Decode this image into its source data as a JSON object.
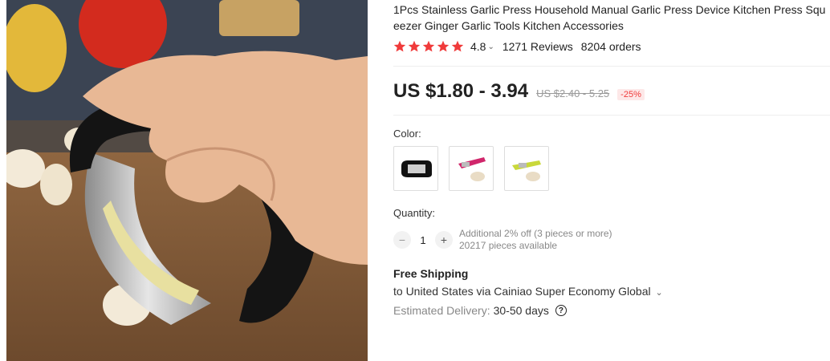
{
  "product": {
    "title_line1": "1Pcs Stainless Garlic Press Household Manual Garlic Press Device Kitchen Press Squ",
    "title_line2": "eezer Ginger Garlic Tools Kitchen Accessories",
    "image_icon": "garlic-press-photo"
  },
  "rating": {
    "stars": 5,
    "value": "4.8",
    "reviews": "1271 Reviews",
    "orders": "8204 orders",
    "star_color": "#f03b3b"
  },
  "price": {
    "current": "US $1.80 - 3.94",
    "original": "US $2.40 - 5.25",
    "discount": "-25%"
  },
  "color": {
    "label": "Color:",
    "options": [
      {
        "icon": "black-garlic-press-icon"
      },
      {
        "icon": "pink-garlic-press-icon"
      },
      {
        "icon": "yellow-garlic-press-icon"
      }
    ]
  },
  "quantity": {
    "label": "Quantity:",
    "value": "1",
    "minus": "−",
    "plus": "+",
    "note_line1": "Additional 2% off (3 pieces or more)",
    "note_line2": "20217 pieces available"
  },
  "shipping": {
    "title": "Free Shipping",
    "line": "to United States via Cainiao Super Economy Global",
    "chevron": "⌄",
    "delivery_label": "Estimated Delivery:",
    "delivery_days": "30-50 days",
    "help": "?"
  }
}
